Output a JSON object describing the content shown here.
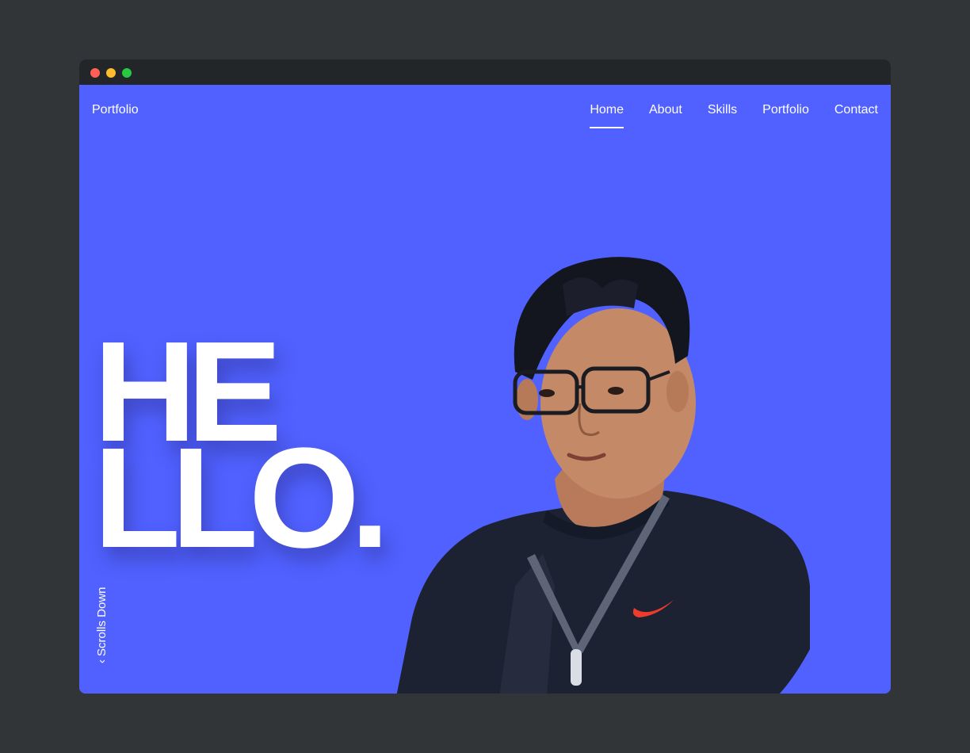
{
  "navbar": {
    "brand": "Portfolio",
    "links": [
      {
        "label": "Home",
        "active": true
      },
      {
        "label": "About",
        "active": false
      },
      {
        "label": "Skills",
        "active": false
      },
      {
        "label": "Portfolio",
        "active": false
      },
      {
        "label": "Contact",
        "active": false
      }
    ]
  },
  "hero": {
    "line1": "HE",
    "line2": "LLO.",
    "scroll_label": "Scrolls Down",
    "scroll_icon": "chevron-left-icon",
    "photo": "portrait-photo"
  },
  "colors": {
    "background": "#5061ff",
    "text": "#ffffff",
    "titlebar": "#232629",
    "page_outer": "#323538"
  }
}
